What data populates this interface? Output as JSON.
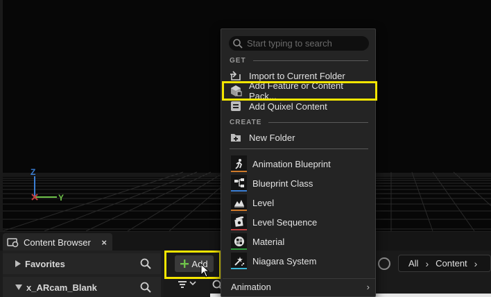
{
  "viewport": {
    "axis_labels": {
      "z": "Z",
      "x": "X",
      "y": "Y"
    }
  },
  "content_browser": {
    "tab_label": "Content Browser",
    "tab_close": "×",
    "favorites_label": "Favorites",
    "project_label": "x_ARcam_Blank",
    "add_button_label": "Add",
    "breadcrumb": [
      "All",
      "Content"
    ]
  },
  "add_menu": {
    "search_placeholder": "Start typing to search",
    "section_get": "GET",
    "section_create": "CREATE",
    "get_items": [
      {
        "label": "Import to Current Folder",
        "icon": "import-icon"
      },
      {
        "label": "Add Feature or Content Pack...",
        "icon": "feature-pack-icon"
      },
      {
        "label": "Add Quixel Content",
        "icon": "quixel-icon"
      }
    ],
    "create_items": [
      {
        "label": "New Folder",
        "icon": "new-folder-icon"
      }
    ],
    "asset_items": [
      {
        "label": "Animation Blueprint",
        "icon": "animation-blueprint-icon",
        "color": "#d07a2a"
      },
      {
        "label": "Blueprint Class",
        "icon": "blueprint-class-icon",
        "color": "#3a7ed4"
      },
      {
        "label": "Level",
        "icon": "level-icon",
        "color": "#d07a2a"
      },
      {
        "label": "Level Sequence",
        "icon": "level-sequence-icon",
        "color": "#c04040"
      },
      {
        "label": "Material",
        "icon": "material-icon",
        "color": "#2e9c3c"
      },
      {
        "label": "Niagara System",
        "icon": "niagara-icon",
        "color": "#3ab8d8"
      }
    ],
    "submenu_animation": "Animation"
  },
  "colors": {
    "highlight": "#f5e600",
    "add_plus": "#6fc24a"
  }
}
